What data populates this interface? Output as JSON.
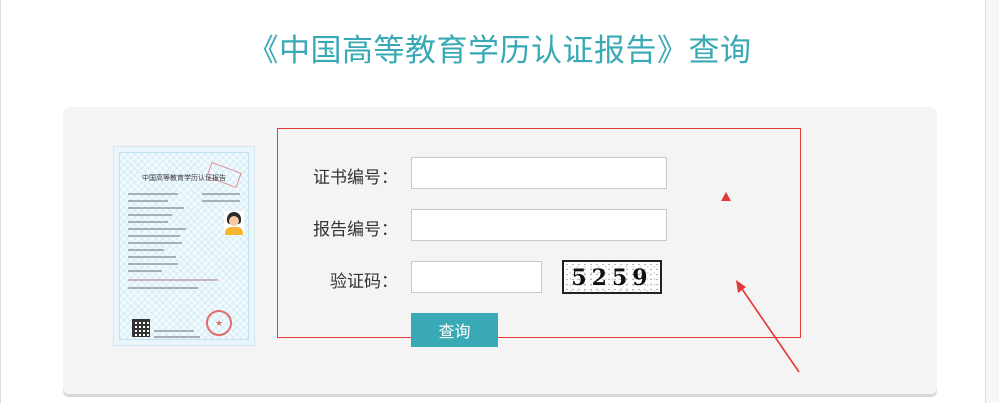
{
  "page": {
    "title": "《中国高等教育学历认证报告》查询"
  },
  "certificate_image": {
    "title": "中国高等教育学历认证报告"
  },
  "form": {
    "certificate_number": {
      "label": "证书编号：",
      "value": "",
      "placeholder": ""
    },
    "report_number": {
      "label": "报告编号：",
      "value": "",
      "placeholder": ""
    },
    "verification_code": {
      "label": "验证码：",
      "value": "",
      "placeholder": ""
    },
    "captcha_text": "5259",
    "submit_label": "查询"
  },
  "colors": {
    "accent": "#3aa9b6",
    "annotation": "#e23838",
    "panel_bg": "#f4f4f4"
  }
}
